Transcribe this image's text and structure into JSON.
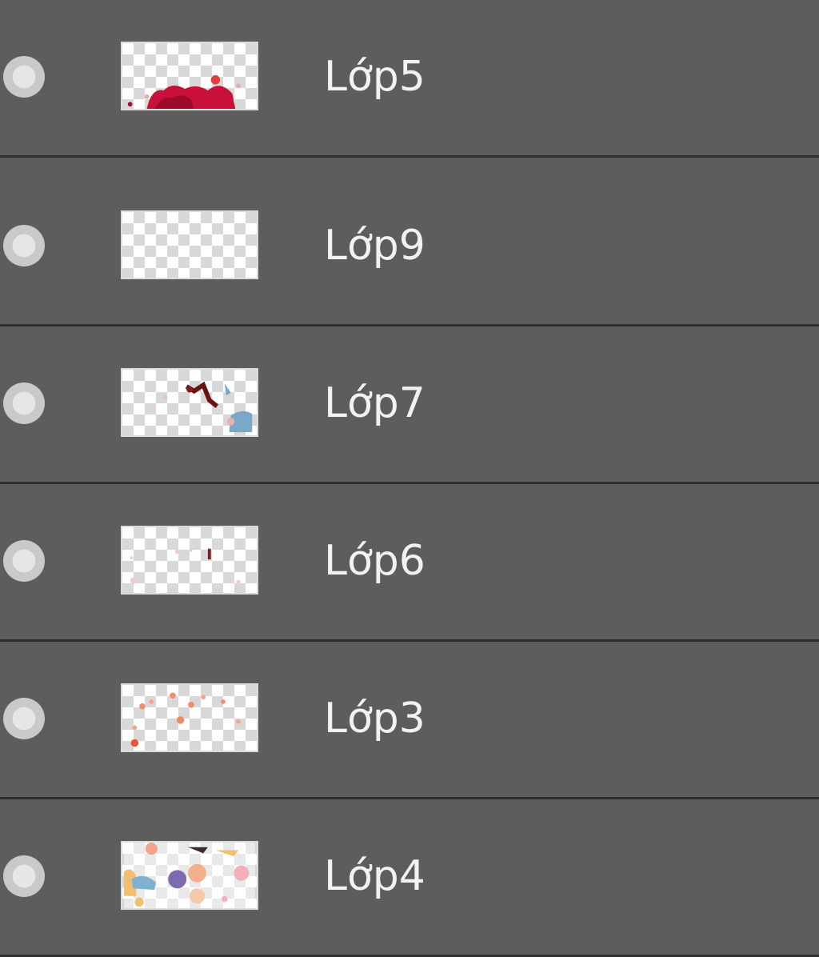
{
  "panel": {
    "layers": [
      {
        "name": "Lớp9",
        "visibility_icon": "visibility-dot-icon"
      },
      {
        "name": "Lớp7",
        "visibility_icon": "visibility-dot-icon"
      },
      {
        "name": "Lớp6",
        "visibility_icon": "visibility-dot-icon"
      },
      {
        "name": "Lớp3",
        "visibility_icon": "visibility-dot-icon"
      },
      {
        "name": "Lớp4",
        "visibility_icon": "visibility-dot-icon"
      },
      {
        "name": "Lớp5",
        "visibility_icon": "visibility-dot-icon"
      }
    ]
  },
  "colors": {
    "panel_background": "#5d5d5d",
    "divider": "#2e2e2e",
    "text": "#f2f2f2"
  }
}
